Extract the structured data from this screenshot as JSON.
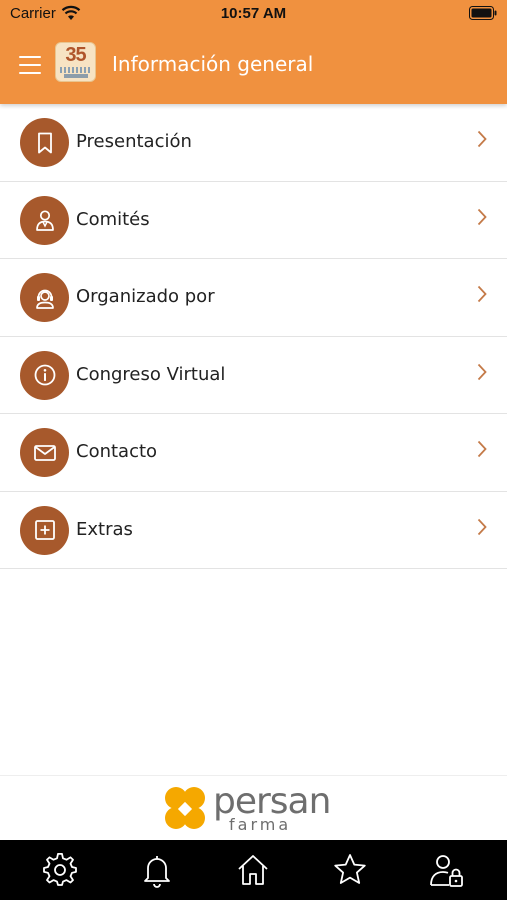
{
  "status": {
    "carrier": "Carrier",
    "time": "10:57 AM"
  },
  "header": {
    "title": "Información general",
    "logo_text": "35",
    "menu_icon": "hamburger-icon"
  },
  "menu": {
    "items": [
      {
        "label": "Presentación",
        "icon": "bookmark-icon"
      },
      {
        "label": "Comités",
        "icon": "person-icon"
      },
      {
        "label": "Organizado por",
        "icon": "headset-icon"
      },
      {
        "label": "Congreso Virtual",
        "icon": "info-icon"
      },
      {
        "label": "Contacto",
        "icon": "mail-icon"
      },
      {
        "label": "Extras",
        "icon": "plus-square-icon"
      }
    ]
  },
  "sponsor": {
    "brand": "persan",
    "brand_sub": "farma",
    "brand_color": "#f5a800"
  },
  "tabs": [
    "gear-icon",
    "bell-icon",
    "home-icon",
    "star-icon",
    "user-lock-icon"
  ],
  "colors": {
    "accent": "#f0913f",
    "icon_bg": "#a7592c",
    "tabbar": "#000000"
  }
}
